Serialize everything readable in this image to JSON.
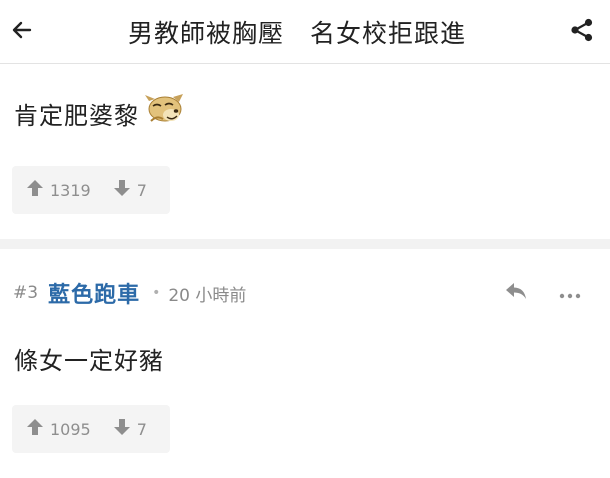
{
  "header": {
    "title": "男教師被胸壓　名女校拒跟進",
    "back_icon": "back-arrow-icon",
    "share_icon": "share-icon"
  },
  "comments": [
    {
      "text": "肯定肥婆黎",
      "emoji": "dog-laughing-icon",
      "upvotes": "1319",
      "downvotes": "7"
    },
    {
      "floor": "#3",
      "username": "藍色跑車",
      "separator": "•",
      "time": "20 小時前",
      "text": "條女一定好豬",
      "upvotes": "1095",
      "downvotes": "7"
    }
  ],
  "colors": {
    "username": "#2c6aa8",
    "meta_text": "#8a8a8a",
    "vote_bg": "#f4f4f4",
    "divider": "#f2f2f2"
  }
}
